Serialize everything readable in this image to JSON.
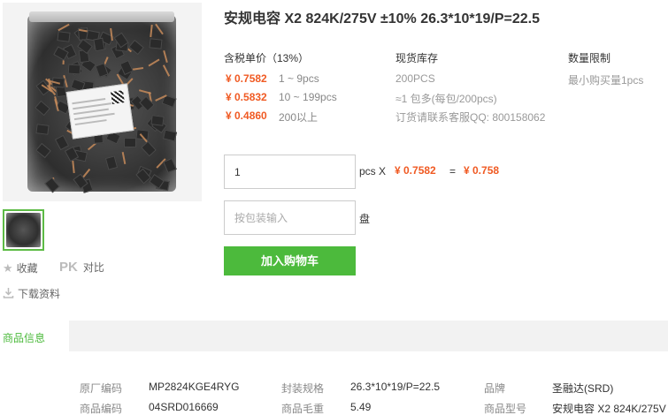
{
  "product": {
    "title": "安规电容 X2 824K/275V ±10% 26.3*10*19/P=22.5"
  },
  "pricing": {
    "header": "含税单价（13%）",
    "tiers": [
      {
        "price": "¥ 0.7582",
        "qty": "1 ~ 9pcs"
      },
      {
        "price": "¥ 0.5832",
        "qty": "10 ~ 199pcs"
      },
      {
        "price": "¥ 0.4860",
        "qty": "200以上"
      }
    ]
  },
  "stock": {
    "header": "现货库存",
    "lines": [
      "200PCS",
      "≈1 包多(每包/200pcs)",
      "订货请联系客服QQ: 800158062"
    ]
  },
  "limit": {
    "header": "数量限制",
    "text": "最小购买量1pcs"
  },
  "order": {
    "qty_value": "1",
    "unit_label": "pcs X",
    "unit_price": "¥ 0.7582",
    "equals": "=",
    "total": "¥ 0.758",
    "pack_placeholder": "按包装输入",
    "pack_unit": "盘",
    "add_cart_label": "加入购物车"
  },
  "side": {
    "favorite_label": "收藏",
    "pk_label": "PK",
    "compare_label": "对比",
    "download_label": "下载资料"
  },
  "info": {
    "tab_label": "商品信息",
    "specs": [
      {
        "key": "原厂编码",
        "value": "MP2824KGE4RYG"
      },
      {
        "key": "封装规格",
        "value": "26.3*10*19/P=22.5"
      },
      {
        "key": "品牌",
        "value": "圣融达(SRD)"
      },
      {
        "key": "商品编码",
        "value": "04SRD016669"
      },
      {
        "key": "商品毛重",
        "value": "5.49"
      },
      {
        "key": "商品型号",
        "value": "安规电容 X2 824K/275V"
      }
    ]
  },
  "colors": {
    "accent_green": "#4cba3c",
    "price_orange": "#f05a23"
  },
  "icons": [
    "star-icon",
    "download-icon",
    "pk-icon"
  ]
}
